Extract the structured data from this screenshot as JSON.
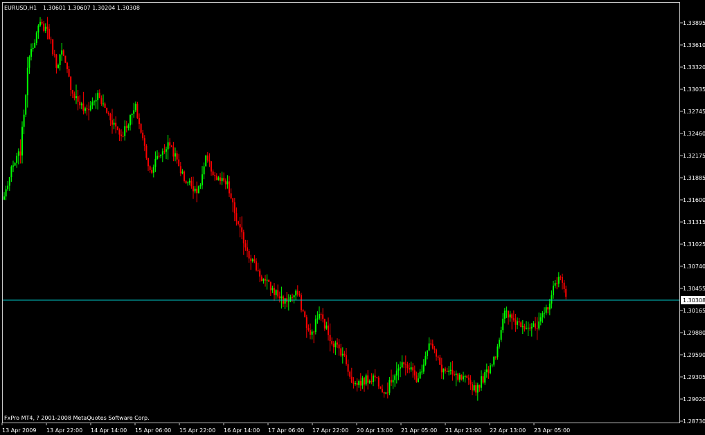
{
  "header": {
    "symbol_label": "EURUSD,H1",
    "ohlc_label": "1.30601 1.30607 1.30204 1.30308"
  },
  "footer": {
    "copyright": "FxPro MT4, ? 2001-2008 MetaQuotes Software Corp."
  },
  "colors": {
    "background": "#000000",
    "axis": "#c8c8c8",
    "bull": "#00ff00",
    "bear": "#ff0000",
    "bid_line": "#00c8c8",
    "text": "#ffffff"
  },
  "chart_data": {
    "type": "candlestick",
    "symbol": "EURUSD",
    "timeframe": "H1",
    "current_bid": 1.30308,
    "bid_label": "1.30308",
    "y_ticks": [
      "1.33895",
      "1.33610",
      "1.33320",
      "1.33035",
      "1.32745",
      "1.32460",
      "1.32175",
      "1.31885",
      "1.31600",
      "1.31315",
      "1.31025",
      "1.30740",
      "1.30455",
      "1.30165",
      "1.29880",
      "1.29590",
      "1.29305",
      "1.29020",
      "1.28730"
    ],
    "x_ticks": [
      "13 Apr 2009",
      "13 Apr 22:00",
      "14 Apr 14:00",
      "15 Apr 06:00",
      "15 Apr 22:00",
      "16 Apr 14:00",
      "17 Apr 06:00",
      "17 Apr 22:00",
      "20 Apr 13:00",
      "21 Apr 05:00",
      "21 Apr 21:00",
      "22 Apr 13:00",
      "23 Apr 05:00"
    ],
    "ylim": [
      1.2872,
      1.3403
    ],
    "anchors": [
      {
        "i": 0,
        "p": 1.3158
      },
      {
        "i": 4,
        "p": 1.319
      },
      {
        "i": 9,
        "p": 1.3215
      },
      {
        "i": 14,
        "p": 1.334
      },
      {
        "i": 20,
        "p": 1.3375
      },
      {
        "i": 24,
        "p": 1.337
      },
      {
        "i": 29,
        "p": 1.3325
      },
      {
        "i": 32,
        "p": 1.334
      },
      {
        "i": 38,
        "p": 1.329
      },
      {
        "i": 45,
        "p": 1.3265
      },
      {
        "i": 52,
        "p": 1.3285
      },
      {
        "i": 57,
        "p": 1.3265
      },
      {
        "i": 65,
        "p": 1.3235
      },
      {
        "i": 73,
        "p": 1.327
      },
      {
        "i": 81,
        "p": 1.319
      },
      {
        "i": 86,
        "p": 1.321
      },
      {
        "i": 92,
        "p": 1.3225
      },
      {
        "i": 100,
        "p": 1.318
      },
      {
        "i": 108,
        "p": 1.3165
      },
      {
        "i": 112,
        "p": 1.3205
      },
      {
        "i": 118,
        "p": 1.318
      },
      {
        "i": 124,
        "p": 1.3172
      },
      {
        "i": 130,
        "p": 1.312
      },
      {
        "i": 136,
        "p": 1.3085
      },
      {
        "i": 143,
        "p": 1.3055
      },
      {
        "i": 149,
        "p": 1.304
      },
      {
        "i": 156,
        "p": 1.3025
      },
      {
        "i": 163,
        "p": 1.3035
      },
      {
        "i": 170,
        "p": 1.298
      },
      {
        "i": 175,
        "p": 1.301
      },
      {
        "i": 182,
        "p": 1.2975
      },
      {
        "i": 188,
        "p": 1.296
      },
      {
        "i": 194,
        "p": 1.292
      },
      {
        "i": 200,
        "p": 1.2925
      },
      {
        "i": 206,
        "p": 1.293
      },
      {
        "i": 212,
        "p": 1.291
      },
      {
        "i": 218,
        "p": 1.294
      },
      {
        "i": 224,
        "p": 1.2945
      },
      {
        "i": 230,
        "p": 1.2925
      },
      {
        "i": 236,
        "p": 1.2975
      },
      {
        "i": 243,
        "p": 1.294
      },
      {
        "i": 250,
        "p": 1.293
      },
      {
        "i": 256,
        "p": 1.2925
      },
      {
        "i": 262,
        "p": 1.2915
      },
      {
        "i": 268,
        "p": 1.2935
      },
      {
        "i": 273,
        "p": 1.296
      },
      {
        "i": 278,
        "p": 1.301
      },
      {
        "i": 284,
        "p": 1.3
      },
      {
        "i": 290,
        "p": 1.2995
      },
      {
        "i": 296,
        "p": 1.299
      },
      {
        "i": 302,
        "p": 1.302
      },
      {
        "i": 308,
        "p": 1.306
      },
      {
        "i": 312,
        "p": 1.3031
      }
    ]
  }
}
